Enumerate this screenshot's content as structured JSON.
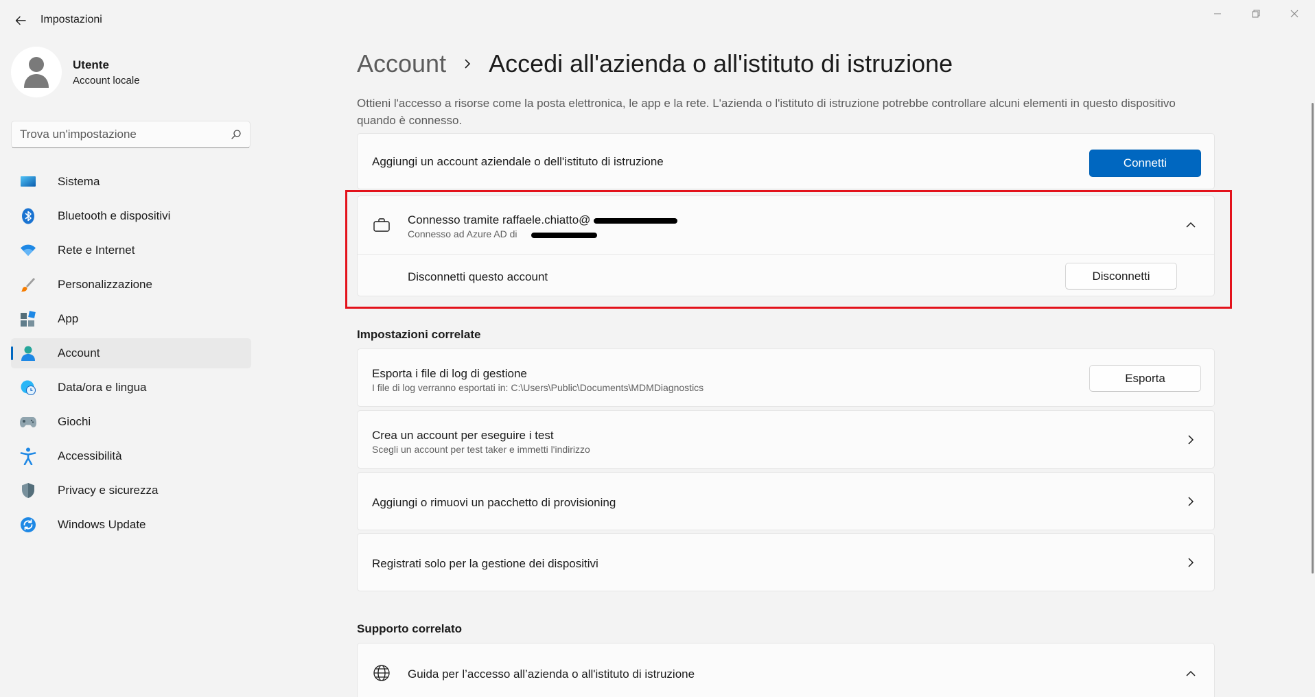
{
  "window": {
    "title": "Impostazioni"
  },
  "profile": {
    "name": "Utente",
    "subtitle": "Account locale"
  },
  "search": {
    "placeholder": "Trova un'impostazione"
  },
  "sidebar": {
    "items": [
      {
        "label": "Sistema",
        "icon": "system-icon",
        "active": false
      },
      {
        "label": "Bluetooth e dispositivi",
        "icon": "bluetooth-icon",
        "active": false
      },
      {
        "label": "Rete e Internet",
        "icon": "wifi-icon",
        "active": false
      },
      {
        "label": "Personalizzazione",
        "icon": "brush-icon",
        "active": false
      },
      {
        "label": "App",
        "icon": "apps-icon",
        "active": false
      },
      {
        "label": "Account",
        "icon": "account-icon",
        "active": true
      },
      {
        "label": "Data/ora e lingua",
        "icon": "globe-clock-icon",
        "active": false
      },
      {
        "label": "Giochi",
        "icon": "gamepad-icon",
        "active": false
      },
      {
        "label": "Accessibilità",
        "icon": "accessibility-icon",
        "active": false
      },
      {
        "label": "Privacy e sicurezza",
        "icon": "shield-icon",
        "active": false
      },
      {
        "label": "Windows Update",
        "icon": "update-icon",
        "active": false
      }
    ]
  },
  "header": {
    "breadcrumb_parent": "Account",
    "breadcrumb_current": "Accedi all'azienda o all'istituto di istruzione"
  },
  "description": "Ottieni l'accesso a risorse come la posta elettronica, le app e la rete. L'azienda o l'istituto di istruzione potrebbe controllare alcuni elementi in questo dispositivo quando è connesso.",
  "add_account": {
    "label": "Aggiungi un account aziendale o dell'istituto di istruzione",
    "button": "Connetti"
  },
  "connected_account": {
    "title": "Connesso tramite raffaele.chiatto@",
    "subtitle": "Connesso ad Azure AD di",
    "disconnect_label": "Disconnetti questo account",
    "disconnect_button": "Disconnetti"
  },
  "related_settings": {
    "heading": "Impostazioni correlate",
    "items": [
      {
        "title": "Esporta i file di log di gestione",
        "subtitle": "I file di log verranno esportati in: C:\\Users\\Public\\Documents\\MDMDiagnostics",
        "button": "Esporta"
      },
      {
        "title": "Crea un account per eseguire i test",
        "subtitle": "Scegli un account per test taker e immetti l'indirizzo"
      },
      {
        "title": "Aggiungi o rimuovi un pacchetto di provisioning"
      },
      {
        "title": "Registrati solo per la gestione dei dispositivi"
      }
    ]
  },
  "related_support": {
    "heading": "Supporto correlato",
    "items": [
      {
        "title": "Guida per l’accesso all’azienda o all'istituto di istruzione"
      }
    ]
  },
  "colors": {
    "accent": "#0067c0",
    "highlight": "#e3121b",
    "background": "#f3f3f3"
  }
}
